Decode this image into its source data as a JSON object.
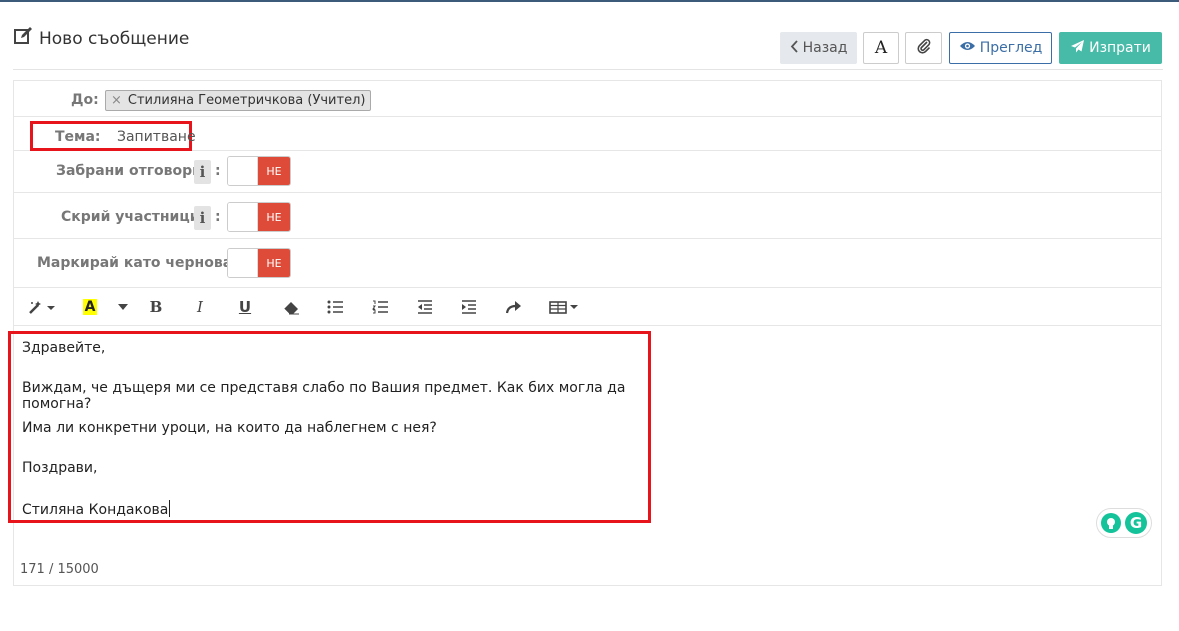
{
  "header": {
    "title": "Ново съобщение",
    "buttons": {
      "back": "Назад",
      "font": "A",
      "preview": "Преглед",
      "send": "Изпрати"
    }
  },
  "form": {
    "to_label": "До:",
    "recipient": "Стилияна Геометричкова (Учител)",
    "recipient_remove": "×",
    "subject_label": "Тема:",
    "subject_value": "Запитване",
    "toggles": [
      {
        "label": "Забрани отговори",
        "has_info": true,
        "colon": ":",
        "state": "НЕ"
      },
      {
        "label": "Скрий участници",
        "has_info": true,
        "colon": ":",
        "state": "НЕ"
      },
      {
        "label": "Маркирай като чернова:",
        "has_info": false,
        "colon": "",
        "state": "НЕ"
      }
    ],
    "info_icon": "i"
  },
  "toolbar": {
    "items": [
      "magic-icon",
      "highlight-icon",
      "bold-icon",
      "italic-icon",
      "underline-icon",
      "eraser-icon",
      "bullet-list-icon",
      "numbered-list-icon",
      "outdent-icon",
      "indent-icon",
      "redo-icon",
      "table-icon"
    ],
    "bold": "B",
    "italic": "I",
    "underline": "U",
    "highlight": "A"
  },
  "editor": {
    "lines": [
      "Здравейте,",
      "Виждам, че дъщеря ми се представя слабо по Вашия предмет. Как бих могла да помогна?",
      "Има ли конкретни уроци, на които да наблегнем с нея?",
      "Поздрави,",
      "Стиляна Кондакова"
    ],
    "counter": "171 / 15000"
  },
  "colors": {
    "send": "#47bba8",
    "preview": "#3b6ea6",
    "toggle_off": "#de4b39",
    "highlight_box": "#e8141b",
    "grammarly": "#15c39a"
  }
}
